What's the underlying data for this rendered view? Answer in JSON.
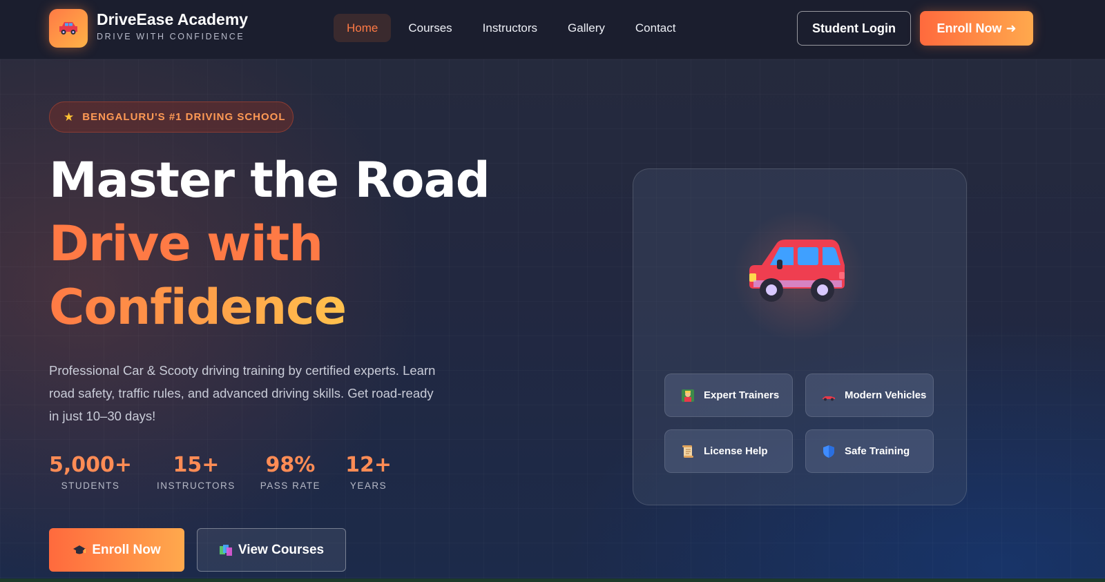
{
  "brand": {
    "name": "DriveEase Academy",
    "tagline": "DRIVE WITH CONFIDENCE",
    "logo_icon": "car-icon"
  },
  "nav": {
    "links": [
      {
        "label": "Home",
        "active": true
      },
      {
        "label": "Courses",
        "active": false
      },
      {
        "label": "Instructors",
        "active": false
      },
      {
        "label": "Gallery",
        "active": false
      },
      {
        "label": "Contact",
        "active": false
      }
    ],
    "login_label": "Student Login",
    "enroll_label": "Enroll Now",
    "enroll_arrow": "➜"
  },
  "hero": {
    "badge": "BENGALURU'S #1 DRIVING SCHOOL",
    "title_line1": "Master the Road",
    "title_line2": "Drive with",
    "title_line3": "Confidence",
    "description": "Professional Car & Scooty driving training by certified experts. Learn road safety, traffic rules, and advanced driving skills. Get road-ready in just 10–30 days!",
    "stats": [
      {
        "value": "5,000+",
        "label": "STUDENTS"
      },
      {
        "value": "15+",
        "label": "INSTRUCTORS"
      },
      {
        "value": "98%",
        "label": "PASS RATE"
      },
      {
        "value": "12+",
        "label": "YEARS"
      }
    ],
    "cta_primary": "Enroll Now",
    "cta_secondary": "View Courses"
  },
  "card": {
    "features": [
      {
        "label": "Expert Trainers",
        "icon": "trainer-icon"
      },
      {
        "label": "Modern Vehicles",
        "icon": "race-car-icon"
      },
      {
        "label": "License Help",
        "icon": "scroll-icon"
      },
      {
        "label": "Safe Training",
        "icon": "shield-icon"
      }
    ]
  },
  "colors": {
    "accent": "#ff7a45",
    "accent_gradient_end": "#ffb347",
    "nav_bg": "#1b1e2e",
    "badge_text": "#ff9a55"
  }
}
